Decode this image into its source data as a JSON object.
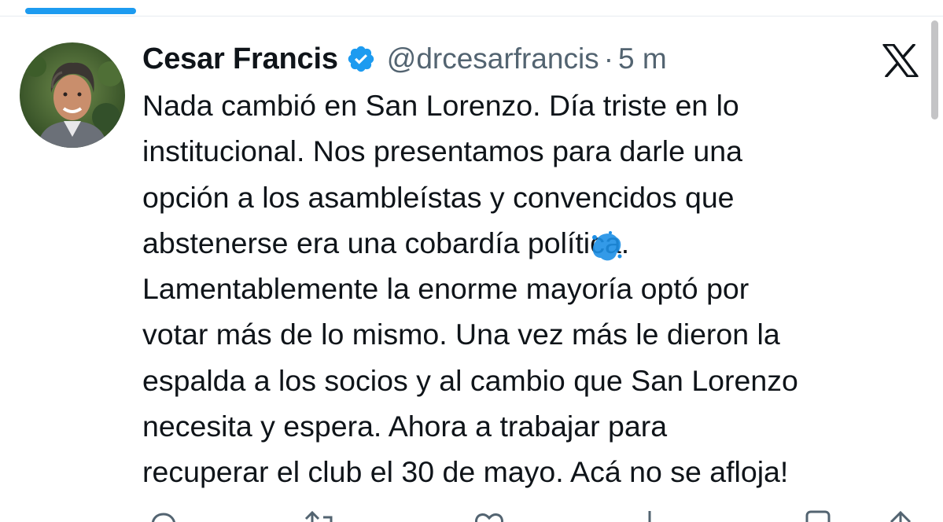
{
  "header": {
    "display_name": "Cesar Francis",
    "handle": "@drcesarfrancis",
    "separator": "·",
    "timestamp": "5 m"
  },
  "icons": {
    "verified": "verified-badge-icon",
    "platform": "x-logo-icon",
    "reply": "reply-icon",
    "repost": "repost-icon",
    "like": "heart-icon",
    "views": "views-icon",
    "bookmark": "bookmark-icon",
    "share": "share-icon"
  },
  "tweet": {
    "lines": [
      "Nada cambió en San Lorenzo. Día triste en lo",
      "institucional. Nos presentamos para darle una",
      "opción a los asambleístas y convencidos que",
      "abstenerse era una cobardía política.",
      "Lamentablemente la enorme mayoría optó por",
      "votar más de lo mismo. Una vez más le dieron la",
      "espalda a los socios y al cambio que San Lorenzo",
      "necesita y espera. Ahora a trabajar para",
      "recuperar el club el 30 de mayo. Acá no se afloja!"
    ]
  },
  "colors": {
    "accent": "#1d9bf0",
    "text": "#0f1419",
    "secondary": "#536471"
  }
}
